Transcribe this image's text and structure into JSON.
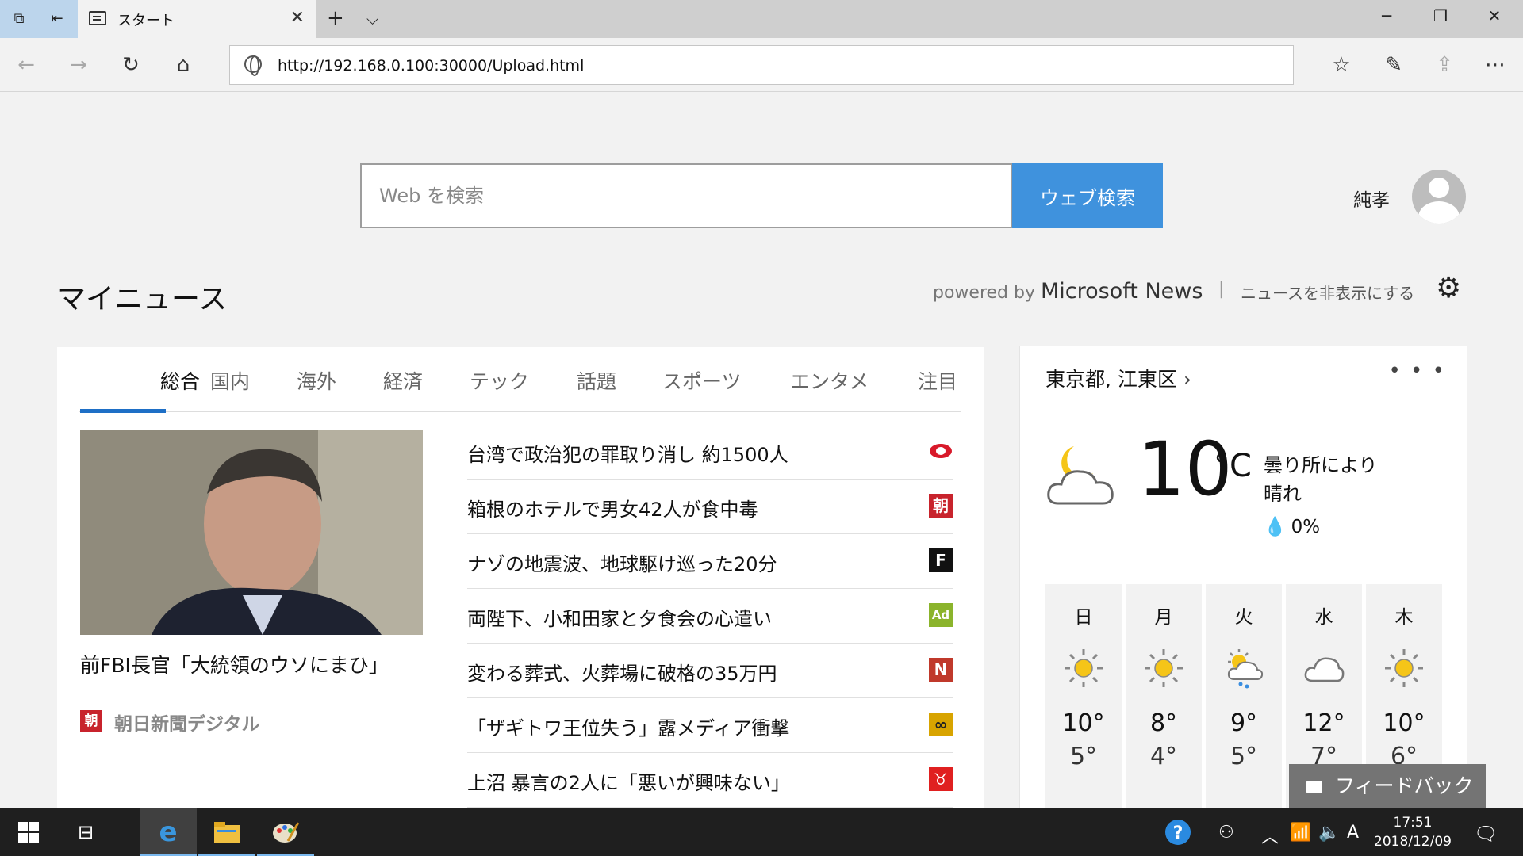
{
  "browser": {
    "tab_title": "スタート",
    "url": "http://192.168.0.100:30000/Upload.html"
  },
  "search": {
    "placeholder": "Web を検索",
    "button_label": "ウェブ検索"
  },
  "user": {
    "name": "純孝"
  },
  "news_header": {
    "title": "マイニュース",
    "powered_prefix": "powered by",
    "powered_brand": "Microsoft News",
    "separator": "|",
    "hide_label": "ニュースを非表示にする"
  },
  "categories": [
    "総合",
    "国内",
    "海外",
    "経済",
    "テック",
    "話題",
    "スポーツ",
    "エンタメ",
    "注目"
  ],
  "active_category": "総合",
  "hero": {
    "title": "前FBI長官「大統領のウソにまひ」",
    "source_badge": "朝",
    "source_name": "朝日新聞デジタル"
  },
  "headlines": [
    {
      "title": "台湾で政治犯の罪取り消し 約1500人",
      "logo_icon": "red-eye-logo-icon",
      "logo_text": "",
      "logo_color": "#d8192a"
    },
    {
      "title": "箱根のホテルで男女42人が食中毒",
      "logo_icon": "asahi-logo-icon",
      "logo_text": "朝",
      "logo_color": "#c8232c"
    },
    {
      "title": "ナゾの地震波、地球駆け巡った20分",
      "logo_icon": "f-logo-icon",
      "logo_text": "F",
      "logo_color": "#111111"
    },
    {
      "title": "両陛下、小和田家と夕食会の心遣い",
      "logo_icon": "ad-logo-icon",
      "logo_text": "Ad",
      "logo_color": "#8bb42c"
    },
    {
      "title": "変わる葬式、火葬場に破格の35万円",
      "logo_icon": "n-logo-icon",
      "logo_text": "N",
      "logo_color": "#c0392b"
    },
    {
      "title": "「ザギトワ王位失う」露メディア衝撃",
      "logo_icon": "chain-logo-icon",
      "logo_text": "∞",
      "logo_color": "#d8a400"
    },
    {
      "title": "上沼 暴言の2人に「悪いが興味ない」",
      "logo_icon": "bull-logo-icon",
      "logo_text": "♉",
      "logo_color": "#e02020"
    }
  ],
  "weather": {
    "location": "東京都, 江東区",
    "temp": "10",
    "unit": "°C",
    "condition_line1": "曇り所により",
    "condition_line2": "晴れ",
    "precip": "0%",
    "current_icon": "moon-cloud-icon",
    "forecast": [
      {
        "day": "日",
        "icon": "sun-icon",
        "hi": "10°",
        "lo": "5°"
      },
      {
        "day": "月",
        "icon": "sun-icon",
        "hi": "8°",
        "lo": "4°"
      },
      {
        "day": "火",
        "icon": "sun-rain-cloud-icon",
        "hi": "9°",
        "lo": "5°"
      },
      {
        "day": "水",
        "icon": "cloud-icon",
        "hi": "12°",
        "lo": "7°"
      },
      {
        "day": "木",
        "icon": "sun-icon",
        "hi": "10°",
        "lo": "6°"
      }
    ]
  },
  "feedback_label": "フィードバック",
  "taskbar": {
    "time": "17:51",
    "date": "2018/12/09",
    "ime": "A"
  },
  "colors": {
    "accent": "#3f92dd",
    "tab_underline": "#1e6fc6",
    "taskbar": "#1f1f1f"
  }
}
